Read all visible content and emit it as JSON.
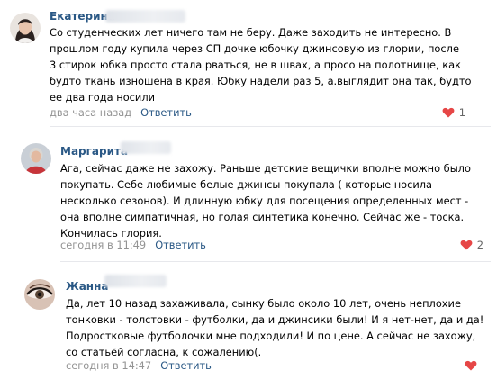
{
  "colors": {
    "link": "#2a5885",
    "meta": "#939393",
    "heart": "#e64646",
    "separator": "#e7e8ec"
  },
  "comments": [
    {
      "author": "Екатерина",
      "text": "Со студенческих лет ничего там не беру. Даже заходить не интересно. В\nпрошлом году купила через СП дочке юбочку джинсовую из глории, после\n3 стирок юбка просто стала рваться, не в швах, а просо на полотнище, как\nбудто ткань изношена в края. Юбку надели раз 5, а.выглядит она так, будто\nее два года носили",
      "date": "два часа назад",
      "reply": "Ответить",
      "likes": "1",
      "avatar_icon": "woman-avatar-dark-hair"
    },
    {
      "author": "Маргарита",
      "text": "Ага, сейчас даже не захожу. Раньше детские вещички вполне можно было\nпокупать. Себе любимые белые джинсы покупала ( которые носила\nнесколько сезонов). И длинную юбку для посещения определенных мест -\nона вполне симпатичная, но голая синтетика конечно. Сейчас же - тоска.\nКончилась глория.",
      "date": "сегодня в 11:49",
      "reply": "Ответить",
      "likes": "2",
      "avatar_icon": "woman-avatar-red-top"
    },
    {
      "author": "Жанна",
      "text": "Да, лет 10 назад захаживала, сынку было около 10 лет, очень неплохие\nтонковки - толстовки - футболки, да и джинсики были! И я нет-нет, да и да!\nПодростковые футболочки мне подходили! И по цене. А сейчас не захожу,\nсо статьёй согласна, к сожалению(.",
      "date": "сегодня в 14:47",
      "reply": "Ответить",
      "likes": "",
      "avatar_icon": "eye-closeup-avatar"
    }
  ]
}
